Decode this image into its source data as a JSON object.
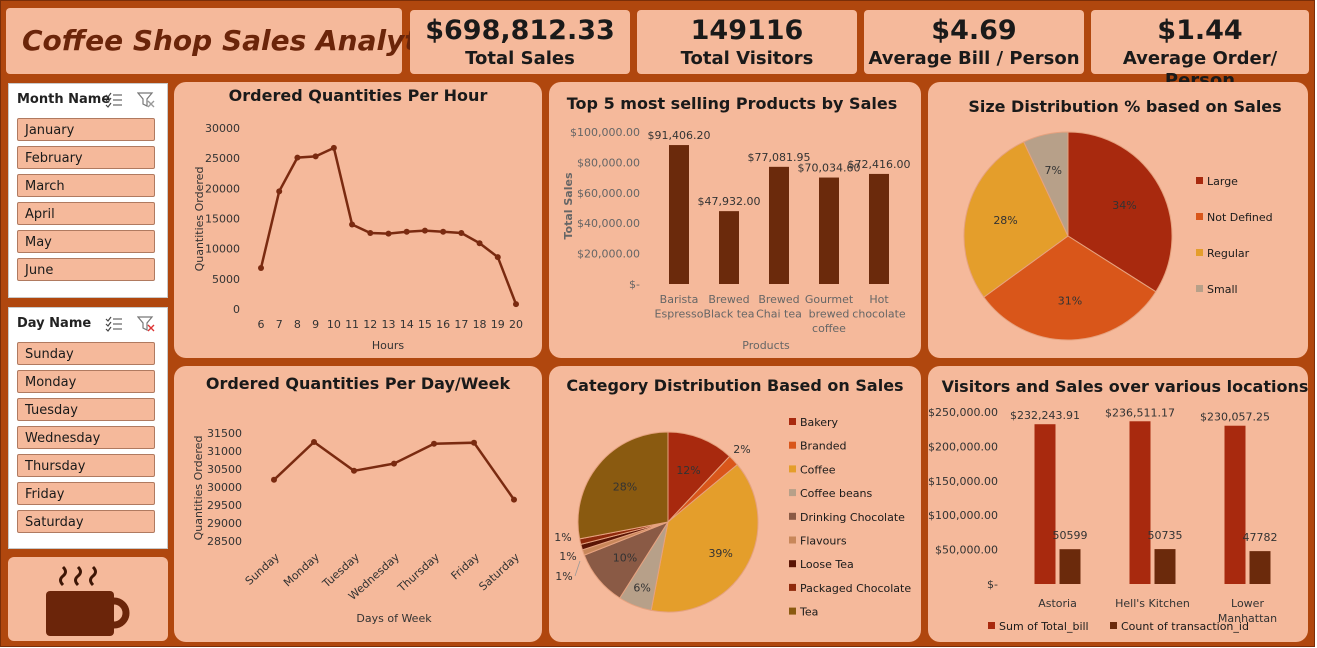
{
  "header": {
    "title": "Coffee Shop Sales Analytics"
  },
  "kpis": [
    {
      "value": "$698,812.33",
      "label": "Total Sales"
    },
    {
      "value": "149116",
      "label": "Total Visitors"
    },
    {
      "value": "$4.69",
      "label": "Average Bill / Person"
    },
    {
      "value": "$1.44",
      "label": "Average Order/ Person"
    }
  ],
  "slicers": {
    "month": {
      "header": "Month Name",
      "items": [
        "January",
        "February",
        "March",
        "April",
        "May",
        "June"
      ]
    },
    "day": {
      "header": "Day Name",
      "items": [
        "Sunday",
        "Monday",
        "Tuesday",
        "Wednesday",
        "Thursday",
        "Friday",
        "Saturday"
      ]
    }
  },
  "icons": {
    "logo": "coffee-cup-icon",
    "multi_select": "multi-select-icon",
    "clear_filter": "clear-filter-icon"
  },
  "colors": {
    "line": "#7a2a10",
    "bar_dark": "#6b2a0c",
    "bar_red": "#a8290e",
    "panel": "#f5b99b",
    "frame": "#b0470e"
  },
  "chart_data": [
    {
      "id": "hourly",
      "type": "line",
      "title": "Ordered Quantities Per Hour",
      "xlabel": "Hours",
      "ylabel": "Quantities Ordered",
      "x": [
        6,
        7,
        8,
        9,
        10,
        11,
        12,
        13,
        14,
        15,
        16,
        17,
        18,
        19,
        20
      ],
      "y": [
        6800,
        19500,
        25100,
        25300,
        26700,
        14000,
        12600,
        12500,
        12800,
        13000,
        12800,
        12600,
        10900,
        8600,
        800
      ],
      "ylim": [
        0,
        30000
      ],
      "yticks": [
        "0",
        "5000",
        "10000",
        "15000",
        "20000",
        "25000",
        "30000"
      ]
    },
    {
      "id": "top5",
      "type": "bar",
      "title": "Top 5 most selling Products by Sales",
      "xlabel": "Products",
      "ylabel": "Total Sales",
      "categories": [
        [
          "Barista",
          "Espresso"
        ],
        [
          "Brewed",
          "Black tea"
        ],
        [
          "Brewed",
          "Chai tea"
        ],
        [
          "Gourmet",
          "brewed",
          "coffee"
        ],
        [
          "Hot",
          "chocolate"
        ]
      ],
      "values": [
        91406.2,
        47932.0,
        77081.95,
        70034.6,
        72416.0
      ],
      "labels": [
        "$91,406.20",
        "$47,932.00",
        "$77,081.95",
        "$70,034.60",
        "$72,416.00"
      ],
      "ylim": [
        0,
        100000
      ],
      "yticks": [
        "$-",
        "$20,000.00",
        "$40,000.00",
        "$60,000.00",
        "$80,000.00",
        "$100,000.00"
      ]
    },
    {
      "id": "size",
      "type": "pie",
      "title": "Size Distribution % based on Sales",
      "slices": [
        {
          "name": "Large",
          "value": 34,
          "label": "34%",
          "color": "#a8290e"
        },
        {
          "name": "Not Defined",
          "value": 31,
          "label": "31%",
          "color": "#d9561a"
        },
        {
          "name": "Regular",
          "value": 28,
          "label": "28%",
          "color": "#e49e2b"
        },
        {
          "name": "Small",
          "value": 7,
          "label": "7%",
          "color": "#b7a089"
        }
      ]
    },
    {
      "id": "daily",
      "type": "line",
      "title": "Ordered Quantities Per Day/Week",
      "xlabel": "Days of Week",
      "ylabel": "Quantities Ordered",
      "categories": [
        "Sunday",
        "Monday",
        "Tuesday",
        "Wednesday",
        "Thursday",
        "Friday",
        "Saturday"
      ],
      "y": [
        30200,
        31250,
        30450,
        30650,
        31200,
        31230,
        29650
      ],
      "ylim": [
        28500,
        31500
      ],
      "yticks": [
        "28500",
        "29000",
        "29500",
        "30000",
        "30500",
        "31000",
        "31500"
      ]
    },
    {
      "id": "category",
      "type": "pie",
      "title": "Category Distribution Based on Sales",
      "slices": [
        {
          "name": "Bakery",
          "value": 12,
          "label": "12%",
          "color": "#a8290e"
        },
        {
          "name": "Branded",
          "value": 2,
          "label": "2%",
          "color": "#d9561a"
        },
        {
          "name": "Coffee",
          "value": 39,
          "label": "39%",
          "color": "#e49e2b"
        },
        {
          "name": "Coffee beans",
          "value": 6,
          "label": "6%",
          "color": "#b7a089"
        },
        {
          "name": "Drinking Chocolate",
          "value": 10,
          "label": "10%",
          "color": "#8a5a45"
        },
        {
          "name": "Flavours",
          "value": 1,
          "label": "1%",
          "color": "#c8875a"
        },
        {
          "name": "Loose Tea",
          "value": 1,
          "label": "1%",
          "color": "#5a1505"
        },
        {
          "name": "Packaged Chocolate",
          "value": 1,
          "label": "1%",
          "color": "#8f2a0c"
        },
        {
          "name": "Tea",
          "value": 28,
          "label": "28%",
          "color": "#8a5a10"
        }
      ]
    },
    {
      "id": "locations",
      "type": "bar",
      "title": "Visitors and Sales over various locations",
      "categories": [
        [
          "Astoria"
        ],
        [
          "Hell's Kitchen"
        ],
        [
          "Lower",
          "Manhattan"
        ]
      ],
      "ylim": [
        0,
        250000
      ],
      "yticks": [
        "$-",
        "$50,000.00",
        "$100,000.00",
        "$150,000.00",
        "$200,000.00",
        "$250,000.00"
      ],
      "series": [
        {
          "name": "Sum of Total_bill",
          "values": [
            232243.91,
            236511.17,
            230057.25
          ],
          "labels": [
            "$232,243.91",
            "$236,511.17",
            "$230,057.25"
          ],
          "color": "#a8290e"
        },
        {
          "name": "Count of transaction_id",
          "values": [
            50599,
            50735,
            47782
          ],
          "labels": [
            "50599",
            "50735",
            "47782"
          ],
          "color": "#6b2a0c"
        }
      ]
    }
  ]
}
